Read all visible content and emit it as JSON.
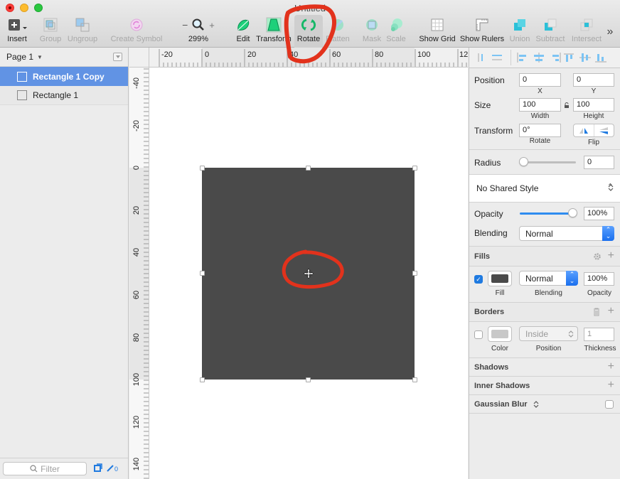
{
  "window": {
    "title": "Untitled"
  },
  "toolbar": {
    "insert": "Insert",
    "group": "Group",
    "ungroup": "Ungroup",
    "create_symbol": "Create Symbol",
    "zoom_minus": "−",
    "zoom_plus": "+",
    "zoom_level": "299%",
    "edit": "Edit",
    "transform": "Transform",
    "rotate": "Rotate",
    "flatten": "Flatten",
    "mask": "Mask",
    "scale": "Scale",
    "show_grid": "Show Grid",
    "show_rulers": "Show Rulers",
    "union": "Union",
    "subtract": "Subtract",
    "intersect": "Intersect",
    "overflow": "»"
  },
  "layers": {
    "page": "Page 1",
    "items": [
      {
        "name": "Rectangle 1 Copy",
        "selected": true
      },
      {
        "name": "Rectangle 1",
        "selected": false
      }
    ],
    "filter_placeholder": "Filter",
    "slice_count": "0"
  },
  "rulers": {
    "horizontal": [
      "-20",
      "0",
      "20",
      "40",
      "60",
      "80",
      "100",
      "12"
    ],
    "vertical": [
      "-40",
      "-20",
      "0",
      "20",
      "40",
      "60",
      "80",
      "100",
      "120",
      "140"
    ]
  },
  "canvas": {
    "shape_fill": "#4a4a4a",
    "annotation_color": "#e2321c"
  },
  "inspector": {
    "position_label": "Position",
    "x": "0",
    "x_label": "X",
    "y": "0",
    "y_label": "Y",
    "size_label": "Size",
    "width": "100",
    "width_label": "Width",
    "height": "100",
    "height_label": "Height",
    "transform_label": "Transform",
    "rotate": "0°",
    "rotate_label": "Rotate",
    "flip_label": "Flip",
    "radius_label": "Radius",
    "radius": "0",
    "shared_style": "No Shared Style",
    "opacity_label": "Opacity",
    "opacity": "100%",
    "opacity_value": 1.0,
    "blending_label": "Blending",
    "blending": "Normal",
    "fills": {
      "title": "Fills",
      "enabled": true,
      "color": "#4a4a4a",
      "blending": "Normal",
      "opacity": "100%",
      "fill_label": "Fill",
      "blending_label": "Blending",
      "opacity_label": "Opacity"
    },
    "borders": {
      "title": "Borders",
      "enabled": false,
      "color": "#c8c8c8",
      "position": "Inside",
      "thickness": "1",
      "color_label": "Color",
      "position_label": "Position",
      "thickness_label": "Thickness"
    },
    "shadows": "Shadows",
    "inner_shadows": "Inner Shadows",
    "gaussian_blur": "Gaussian Blur"
  }
}
